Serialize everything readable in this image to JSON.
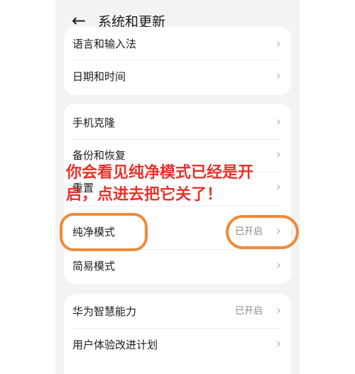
{
  "header": {
    "title": "系统和更新",
    "back_icon": "back-arrow-icon"
  },
  "card1": {
    "items": [
      {
        "label": "语言和输入法"
      },
      {
        "label": "日期和时间"
      }
    ]
  },
  "card2": {
    "items": [
      {
        "label": "手机克隆"
      },
      {
        "label": "备份和恢复"
      },
      {
        "label": "重置"
      },
      {
        "label": "纯净模式",
        "value": "已开启"
      },
      {
        "label": "简易模式"
      }
    ]
  },
  "card3": {
    "items": [
      {
        "label": "华为智慧能力",
        "value": "已开启"
      },
      {
        "label": "用户体验改进计划"
      }
    ]
  },
  "annotation": {
    "text": "你会看见纯净模式已经是开启，点进去把它关了！",
    "color": "#e8322a"
  },
  "highlight_color": "#ef8a3a",
  "chevron_glyph": "›"
}
